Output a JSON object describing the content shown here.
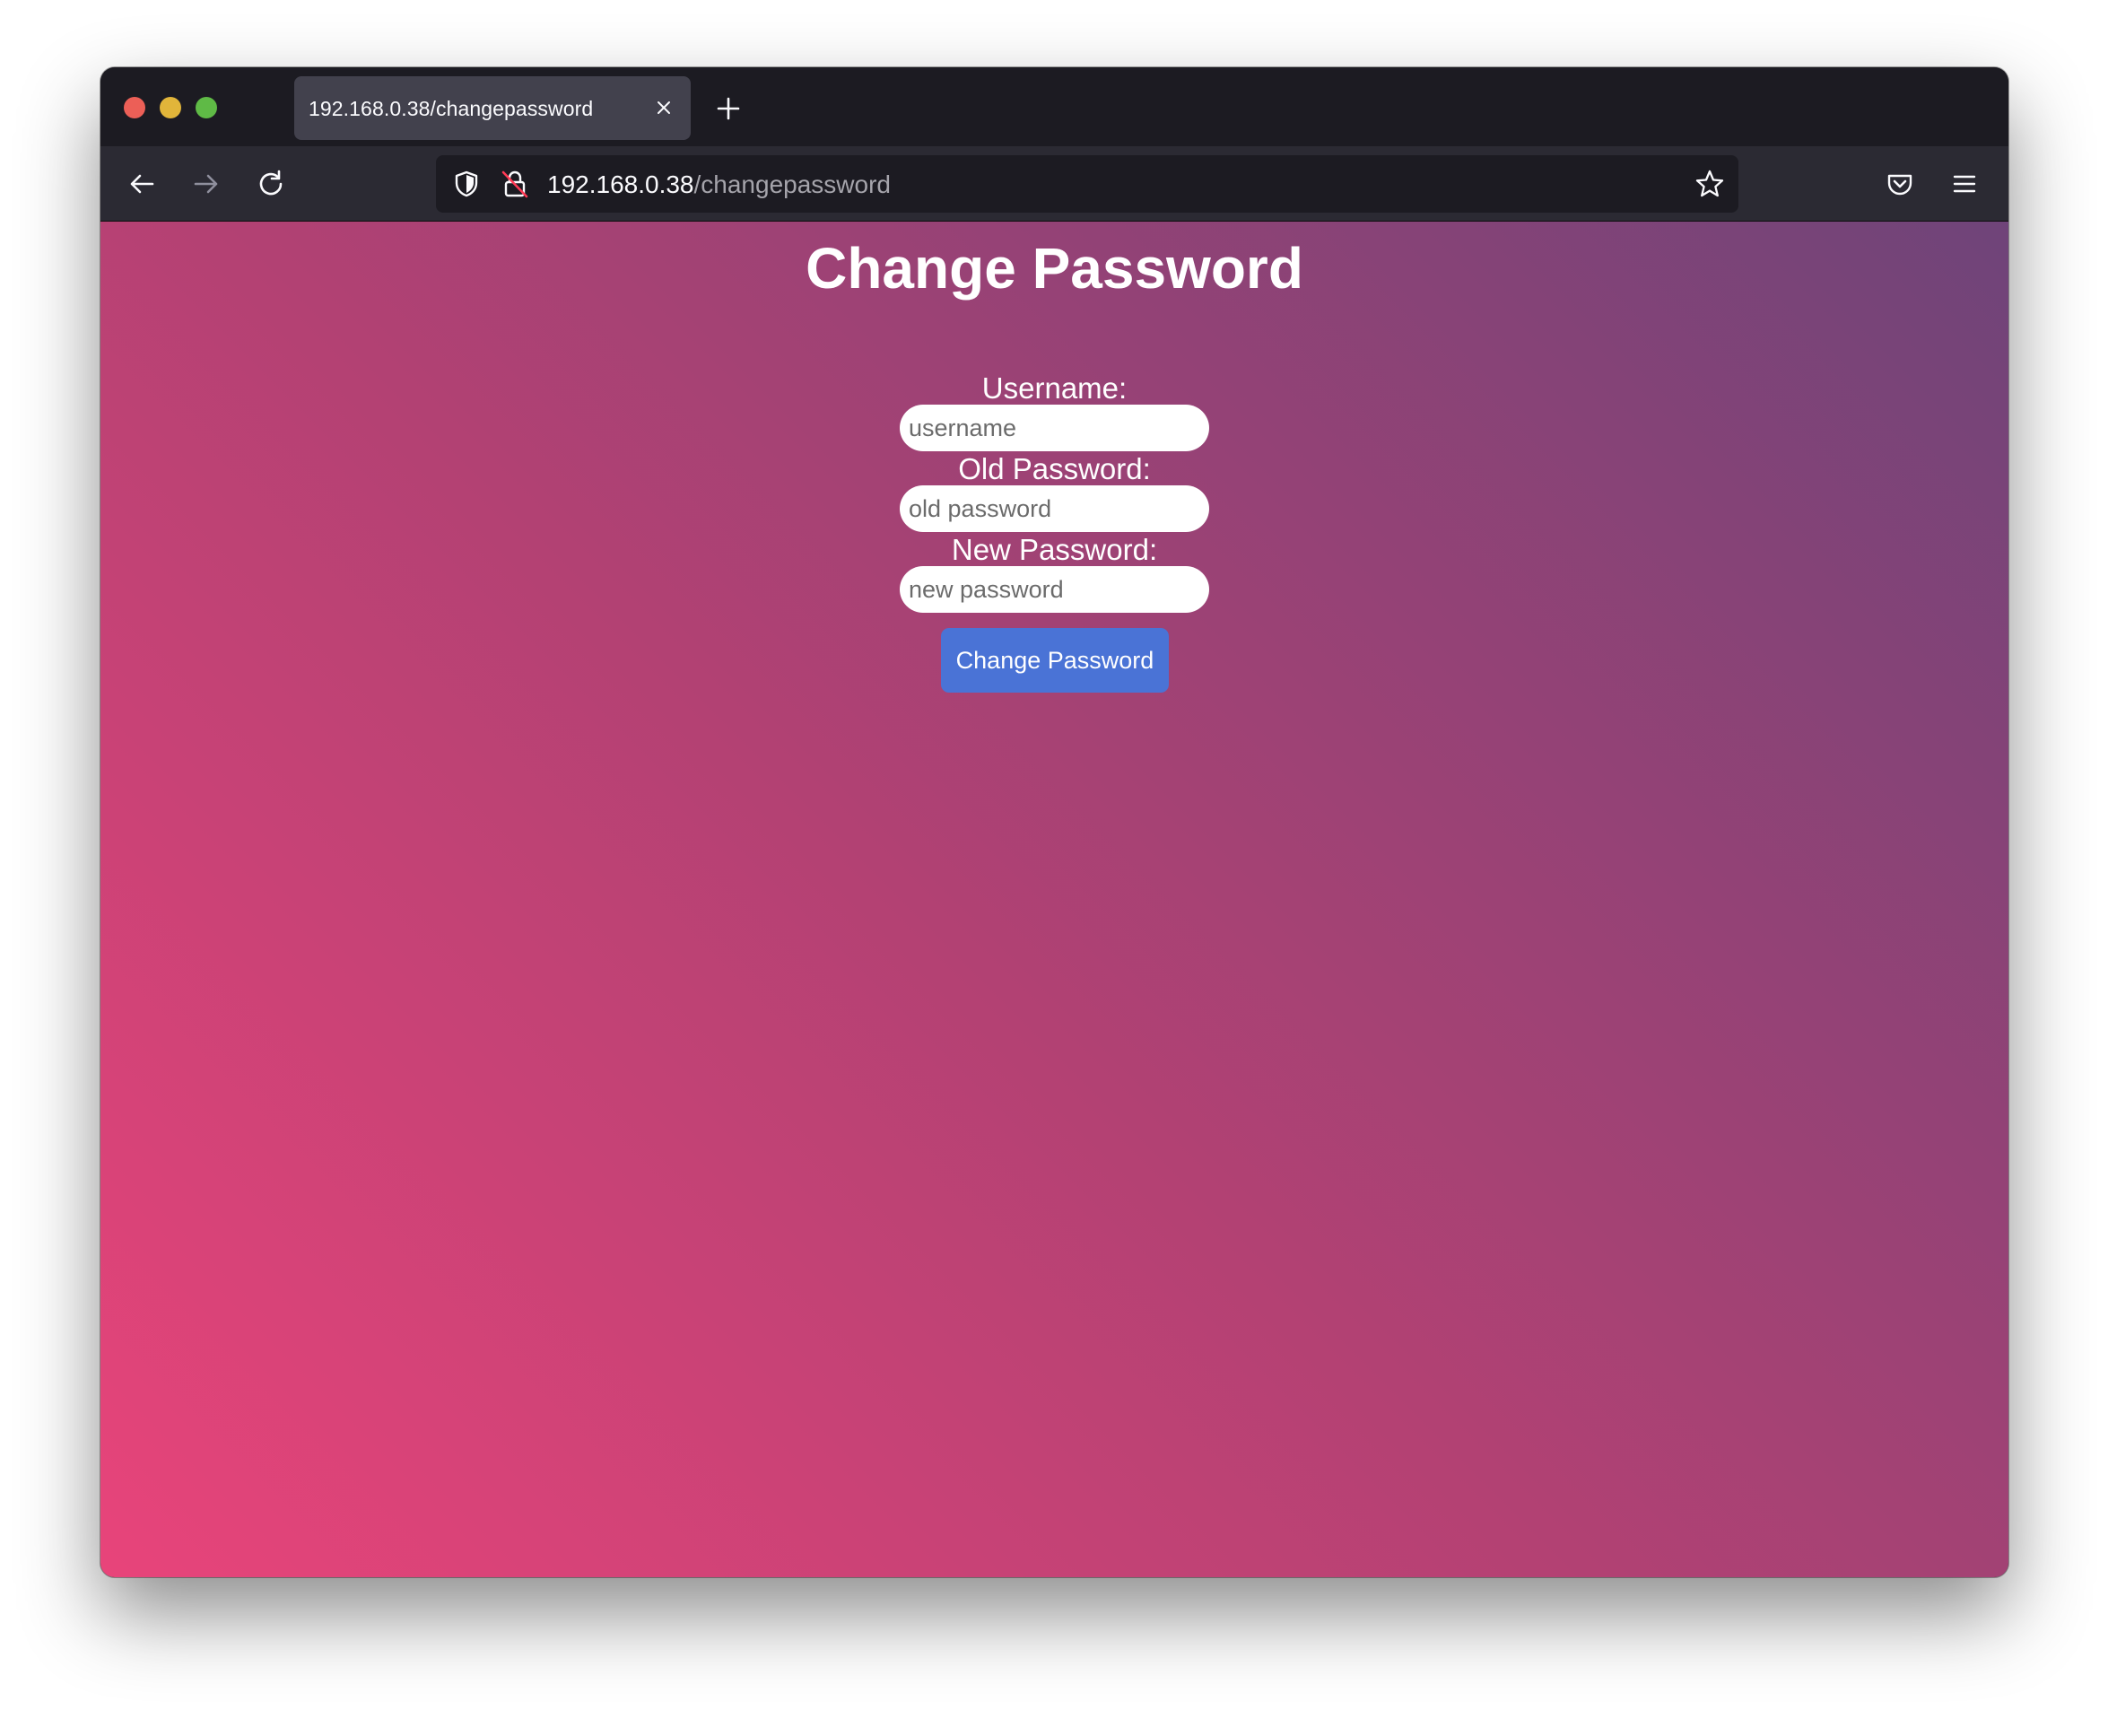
{
  "browser": {
    "tab": {
      "title": "192.168.0.38/changepassword"
    },
    "url": {
      "host": "192.168.0.38",
      "path": "/changepassword"
    },
    "icons": {
      "close_tab": "close-icon",
      "new_tab": "plus-icon",
      "back": "arrow-left-icon",
      "forward": "arrow-right-icon",
      "reload": "reload-icon",
      "tracking": "shield-icon",
      "insecure": "insecure-lock-icon",
      "bookmark": "star-icon",
      "pocket": "pocket-icon",
      "menu": "hamburger-menu-icon"
    }
  },
  "page": {
    "title": "Change Password",
    "fields": {
      "username": {
        "label": "Username:",
        "placeholder": "username"
      },
      "old_password": {
        "label": "Old Password:",
        "placeholder": "old password"
      },
      "new_password": {
        "label": "New Password:",
        "placeholder": "new password"
      }
    },
    "submit_label": "Change Password",
    "colors": {
      "gradient_start": "#e8447a",
      "gradient_end": "#6f4479",
      "button": "#4a73d6"
    }
  }
}
